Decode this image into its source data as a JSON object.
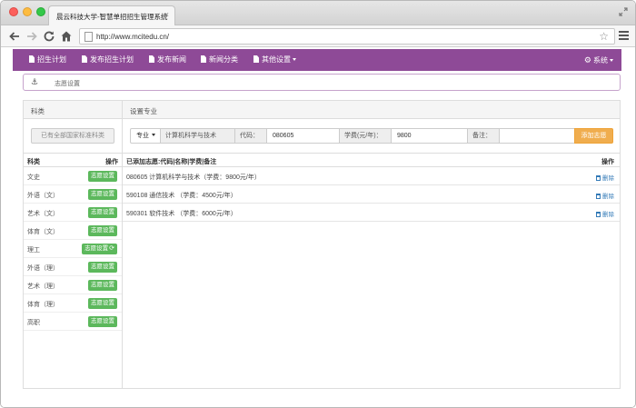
{
  "browser": {
    "tab_title": "晨云科技大学-智慧单招招生管理系统",
    "tab_close": "×",
    "url": "http://www.mcitedu.cn/",
    "star": "☆"
  },
  "navbar": {
    "items": [
      {
        "label": "招生计划"
      },
      {
        "label": "发布招生计划"
      },
      {
        "label": "发布新闻"
      },
      {
        "label": "新闻分类"
      },
      {
        "label": "其他设置"
      }
    ],
    "system_label": "系统"
  },
  "breadcrumb": {
    "anchor": "⚓",
    "text": "志愿设置"
  },
  "left_panel": {
    "title": "科类",
    "standard_button": "已有全部国家标准科类",
    "columns": [
      "科类",
      "操作"
    ],
    "rows": [
      {
        "name": "文史",
        "action": "志愿设置"
      },
      {
        "name": "外语（文）",
        "action": "志愿设置"
      },
      {
        "name": "艺术（文）",
        "action": "志愿设置"
      },
      {
        "name": "体育（文）",
        "action": "志愿设置"
      },
      {
        "name": "理工",
        "action": "志愿设置",
        "icon": "⟳"
      },
      {
        "name": "外语（理）",
        "action": "志愿设置"
      },
      {
        "name": "艺术（理）",
        "action": "志愿设置"
      },
      {
        "name": "体育（理）",
        "action": "志愿设置"
      },
      {
        "name": "高职",
        "action": "志愿设置"
      }
    ]
  },
  "right_panel": {
    "title": "设置专业",
    "form": {
      "major_select": "专业",
      "major_value": "计算机科学与技术",
      "code_label": "代码：",
      "code_value": "080605",
      "fee_label": "学费(元/年)：",
      "fee_value": "9800",
      "note_label": "备注：",
      "note_value": "",
      "add_button": "添加志愿"
    },
    "columns": [
      "已添加志愿:代码|名称|学费|备注",
      "操作"
    ],
    "rows": [
      {
        "text": "080605  计算机科学与技术（学费：9800元/年）",
        "action": "删除"
      },
      {
        "text": "590108  通信技术 （学费：4500元/年）",
        "action": "删除"
      },
      {
        "text": "590301  软件技术 （学费：6000元/年）",
        "action": "删除"
      }
    ]
  }
}
